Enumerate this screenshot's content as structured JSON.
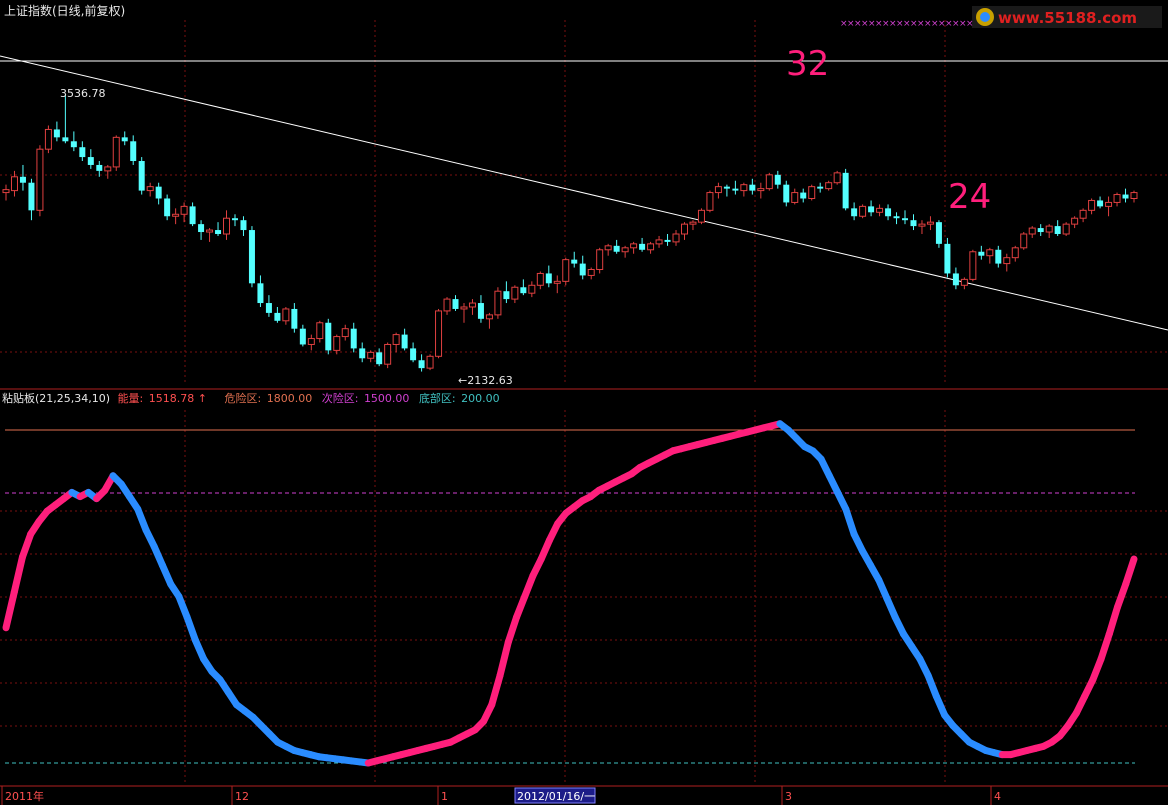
{
  "header": {
    "title": "上证指数(日线,前复权)",
    "watermark": "www.55188.com"
  },
  "annotations": {
    "big_label_1": "32",
    "big_label_2": "24",
    "high_label": "3536.78",
    "low_label": "←2132.63"
  },
  "indicator_header": {
    "name": "粘贴板(21,25,34,10)",
    "energy_label": "能量:",
    "energy_value": "1518.78",
    "energy_arrow": "↑",
    "danger_label": "危险区:",
    "danger_value": "1800.00",
    "sub_label": "次险区:",
    "sub_value": "1500.00",
    "bottom_label": "底部区:",
    "bottom_value": "200.00"
  },
  "time_axis": {
    "labels": [
      "2011年",
      "12",
      "1",
      "3",
      "4"
    ],
    "cursor_label": "2012/01/16/一"
  },
  "colors": {
    "background": "#000000",
    "up": "#e04040",
    "down": "#54ffff",
    "wave_up": "#ff1f7c",
    "wave_down": "#2a8cff",
    "grid": "#7a1010",
    "big_label": "#ff1f7c",
    "danger_line": "#e07050",
    "sub_line": "#d040d0",
    "bottom_line": "#40c0c0"
  },
  "chart_data": [
    {
      "type": "candlestick",
      "title": "上证指数(日线,前复权)",
      "ylim": [
        2100,
        3560
      ],
      "high": 3536.78,
      "low": 2132.63,
      "candles": [
        [
          3040,
          3080,
          3000,
          3055
        ],
        [
          3050,
          3150,
          3020,
          3120
        ],
        [
          3120,
          3180,
          3050,
          3090
        ],
        [
          3090,
          3110,
          2900,
          2950
        ],
        [
          2950,
          3280,
          2920,
          3260
        ],
        [
          3260,
          3380,
          3240,
          3360
        ],
        [
          3360,
          3400,
          3300,
          3320
        ],
        [
          3320,
          3536.78,
          3290,
          3300
        ],
        [
          3300,
          3350,
          3250,
          3270
        ],
        [
          3270,
          3300,
          3200,
          3220
        ],
        [
          3220,
          3260,
          3160,
          3180
        ],
        [
          3180,
          3200,
          3120,
          3150
        ],
        [
          3150,
          3180,
          3110,
          3170
        ],
        [
          3170,
          3330,
          3150,
          3320
        ],
        [
          3320,
          3350,
          3280,
          3300
        ],
        [
          3300,
          3330,
          3180,
          3200
        ],
        [
          3200,
          3220,
          3030,
          3050
        ],
        [
          3050,
          3090,
          3020,
          3070
        ],
        [
          3070,
          3090,
          2980,
          3010
        ],
        [
          3010,
          3030,
          2900,
          2920
        ],
        [
          2920,
          2960,
          2880,
          2930
        ],
        [
          2930,
          2990,
          2890,
          2970
        ],
        [
          2970,
          2990,
          2870,
          2880
        ],
        [
          2880,
          2900,
          2800,
          2840
        ],
        [
          2840,
          2860,
          2790,
          2850
        ],
        [
          2850,
          2890,
          2820,
          2830
        ],
        [
          2830,
          2950,
          2800,
          2910
        ],
        [
          2910,
          2930,
          2870,
          2900
        ],
        [
          2900,
          2920,
          2820,
          2850
        ],
        [
          2850,
          2870,
          2560,
          2580
        ],
        [
          2580,
          2620,
          2460,
          2480
        ],
        [
          2480,
          2520,
          2410,
          2430
        ],
        [
          2430,
          2460,
          2380,
          2390
        ],
        [
          2390,
          2460,
          2370,
          2450
        ],
        [
          2450,
          2480,
          2330,
          2350
        ],
        [
          2350,
          2370,
          2260,
          2270
        ],
        [
          2270,
          2320,
          2240,
          2300
        ],
        [
          2300,
          2390,
          2280,
          2380
        ],
        [
          2380,
          2400,
          2220,
          2240
        ],
        [
          2240,
          2320,
          2220,
          2310
        ],
        [
          2310,
          2370,
          2290,
          2350
        ],
        [
          2350,
          2380,
          2230,
          2250
        ],
        [
          2250,
          2280,
          2180,
          2200
        ],
        [
          2200,
          2240,
          2180,
          2230
        ],
        [
          2230,
          2250,
          2160,
          2170
        ],
        [
          2170,
          2280,
          2150,
          2270
        ],
        [
          2270,
          2330,
          2230,
          2320
        ],
        [
          2320,
          2350,
          2240,
          2250
        ],
        [
          2250,
          2280,
          2180,
          2190
        ],
        [
          2190,
          2220,
          2132.63,
          2150
        ],
        [
          2150,
          2220,
          2140,
          2210
        ],
        [
          2210,
          2450,
          2200,
          2440
        ],
        [
          2440,
          2510,
          2420,
          2500
        ],
        [
          2500,
          2520,
          2440,
          2450
        ],
        [
          2450,
          2480,
          2380,
          2460
        ],
        [
          2460,
          2500,
          2420,
          2480
        ],
        [
          2480,
          2520,
          2380,
          2400
        ],
        [
          2400,
          2430,
          2350,
          2420
        ],
        [
          2420,
          2560,
          2400,
          2540
        ],
        [
          2540,
          2590,
          2480,
          2500
        ],
        [
          2500,
          2570,
          2480,
          2560
        ],
        [
          2560,
          2600,
          2520,
          2530
        ],
        [
          2530,
          2590,
          2510,
          2570
        ],
        [
          2570,
          2640,
          2550,
          2630
        ],
        [
          2630,
          2670,
          2560,
          2580
        ],
        [
          2580,
          2620,
          2530,
          2590
        ],
        [
          2590,
          2710,
          2570,
          2700
        ],
        [
          2700,
          2740,
          2660,
          2680
        ],
        [
          2680,
          2720,
          2600,
          2620
        ],
        [
          2620,
          2660,
          2600,
          2650
        ],
        [
          2650,
          2760,
          2630,
          2750
        ],
        [
          2750,
          2780,
          2720,
          2770
        ],
        [
          2770,
          2800,
          2730,
          2740
        ],
        [
          2740,
          2770,
          2710,
          2760
        ],
        [
          2760,
          2790,
          2730,
          2780
        ],
        [
          2780,
          2810,
          2740,
          2750
        ],
        [
          2750,
          2790,
          2730,
          2780
        ],
        [
          2780,
          2820,
          2760,
          2800
        ],
        [
          2800,
          2830,
          2770,
          2790
        ],
        [
          2790,
          2850,
          2770,
          2830
        ],
        [
          2830,
          2890,
          2800,
          2880
        ],
        [
          2880,
          2900,
          2850,
          2890
        ],
        [
          2890,
          2960,
          2880,
          2950
        ],
        [
          2950,
          3050,
          2940,
          3040
        ],
        [
          3040,
          3090,
          3010,
          3070
        ],
        [
          3070,
          3080,
          3020,
          3060
        ],
        [
          3060,
          3100,
          3030,
          3050
        ],
        [
          3050,
          3090,
          3020,
          3080
        ],
        [
          3080,
          3110,
          3030,
          3050
        ],
        [
          3050,
          3090,
          3010,
          3060
        ],
        [
          3060,
          3140,
          3050,
          3130
        ],
        [
          3130,
          3150,
          3060,
          3080
        ],
        [
          3080,
          3100,
          2970,
          2990
        ],
        [
          2990,
          3060,
          2980,
          3040
        ],
        [
          3040,
          3060,
          2990,
          3010
        ],
        [
          3010,
          3080,
          3000,
          3070
        ],
        [
          3070,
          3090,
          3040,
          3060
        ],
        [
          3060,
          3100,
          3050,
          3090
        ],
        [
          3090,
          3150,
          3080,
          3140
        ],
        [
          3140,
          3160,
          2950,
          2960
        ],
        [
          2960,
          2990,
          2900,
          2920
        ],
        [
          2920,
          2980,
          2910,
          2970
        ],
        [
          2970,
          3000,
          2920,
          2940
        ],
        [
          2940,
          2980,
          2920,
          2960
        ],
        [
          2960,
          2980,
          2900,
          2920
        ],
        [
          2920,
          2940,
          2880,
          2910
        ],
        [
          2910,
          2950,
          2880,
          2900
        ],
        [
          2900,
          2930,
          2850,
          2870
        ],
        [
          2870,
          2900,
          2830,
          2880
        ],
        [
          2880,
          2920,
          2850,
          2890
        ],
        [
          2890,
          2900,
          2760,
          2780
        ],
        [
          2780,
          2810,
          2610,
          2630
        ],
        [
          2630,
          2660,
          2550,
          2570
        ],
        [
          2570,
          2610,
          2550,
          2600
        ],
        [
          2600,
          2750,
          2590,
          2740
        ],
        [
          2740,
          2770,
          2700,
          2720
        ],
        [
          2720,
          2760,
          2680,
          2750
        ],
        [
          2750,
          2770,
          2660,
          2680
        ],
        [
          2680,
          2730,
          2640,
          2710
        ],
        [
          2710,
          2770,
          2690,
          2760
        ],
        [
          2760,
          2840,
          2750,
          2830
        ],
        [
          2830,
          2870,
          2810,
          2860
        ],
        [
          2860,
          2880,
          2820,
          2840
        ],
        [
          2840,
          2880,
          2810,
          2870
        ],
        [
          2870,
          2900,
          2820,
          2830
        ],
        [
          2830,
          2890,
          2820,
          2880
        ],
        [
          2880,
          2920,
          2860,
          2910
        ],
        [
          2910,
          2960,
          2890,
          2950
        ],
        [
          2950,
          3010,
          2930,
          3000
        ],
        [
          3000,
          3020,
          2960,
          2970
        ],
        [
          2970,
          3020,
          2920,
          2990
        ],
        [
          2990,
          3040,
          2970,
          3030
        ],
        [
          3030,
          3060,
          2990,
          3010
        ],
        [
          3010,
          3050,
          2990,
          3040
        ]
      ]
    },
    {
      "type": "line",
      "title": "粘贴板(21,25,34,10)",
      "ylim": [
        200,
        1800
      ],
      "reference_lines": [
        {
          "name": "危险区",
          "value": 1800
        },
        {
          "name": "次险区",
          "value": 1500
        },
        {
          "name": "底部区",
          "value": 200
        }
      ],
      "series": [
        {
          "name": "能量",
          "values": [
            850,
            1020,
            1190,
            1300,
            1360,
            1410,
            1440,
            1470,
            1500,
            1480,
            1500,
            1470,
            1510,
            1580,
            1540,
            1480,
            1420,
            1320,
            1240,
            1150,
            1060,
            1000,
            900,
            790,
            700,
            640,
            600,
            540,
            480,
            450,
            420,
            380,
            340,
            300,
            280,
            260,
            250,
            240,
            230,
            225,
            220,
            215,
            210,
            205,
            200,
            210,
            220,
            230,
            240,
            250,
            260,
            270,
            280,
            290,
            300,
            320,
            340,
            360,
            400,
            480,
            620,
            780,
            900,
            1000,
            1100,
            1180,
            1270,
            1350,
            1400,
            1430,
            1460,
            1480,
            1510,
            1530,
            1550,
            1570,
            1590,
            1620,
            1640,
            1660,
            1680,
            1700,
            1710,
            1720,
            1730,
            1740,
            1750,
            1760,
            1770,
            1780,
            1790,
            1800,
            1810,
            1820,
            1830,
            1800,
            1760,
            1720,
            1700,
            1660,
            1580,
            1500,
            1420,
            1300,
            1220,
            1150,
            1080,
            990,
            900,
            820,
            760,
            700,
            620,
            520,
            430,
            380,
            340,
            300,
            280,
            260,
            250,
            240,
            240,
            250,
            260,
            270,
            280,
            300,
            330,
            380,
            440,
            520,
            600,
            700,
            820,
            950,
            1060,
            1180
          ],
          "up_segments": [
            [
              0,
              16
            ],
            [
              44,
              53
            ],
            [
              55,
              60
            ],
            [
              60,
              90
            ],
            [
              120,
              138
            ]
          ]
        }
      ]
    }
  ]
}
